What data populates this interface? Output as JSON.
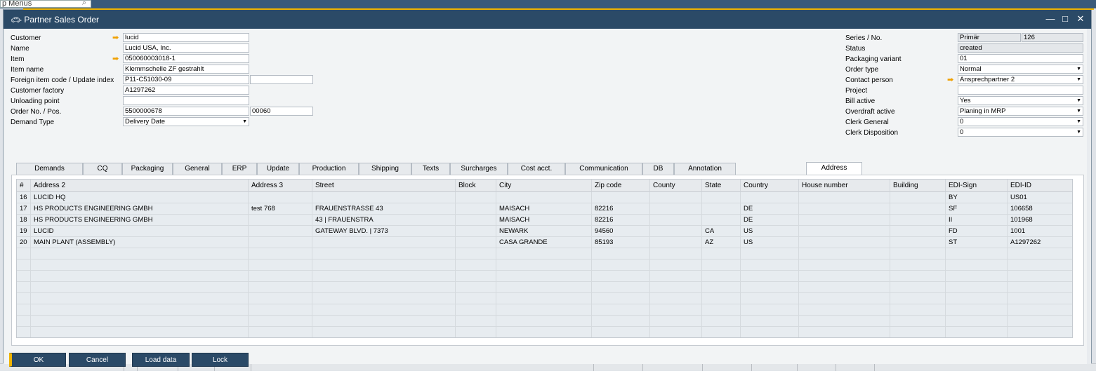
{
  "background": {
    "menu_search_text": "p Menus",
    "search_icon": "search-icon"
  },
  "window": {
    "title": "- Partner Sales Order",
    "icon": "car-icon",
    "accent_color": "#f0b400",
    "titlebar_color": "#2b4a67"
  },
  "left_fields": {
    "customer": {
      "label": "Customer",
      "value": "lucid"
    },
    "name": {
      "label": "Name",
      "value": "Lucid USA, Inc."
    },
    "item": {
      "label": "Item",
      "value": "050060003018-1"
    },
    "item_name": {
      "label": "Item name",
      "value": "Klemmschelle ZF gestrahlt"
    },
    "foreign_item": {
      "label": "Foreign item code / Update index",
      "value": "P11-C51030-09",
      "value2": ""
    },
    "customer_factory": {
      "label": "Customer factory",
      "value": "A1297262"
    },
    "unloading_point": {
      "label": "Unloading point",
      "value": ""
    },
    "order_no": {
      "label": "Order No. / Pos.",
      "value": "5500000678",
      "value2": "00060"
    },
    "demand_type": {
      "label": "Demand Type",
      "value": "Delivery Date"
    }
  },
  "right_fields": {
    "series": {
      "label": "Series / No.",
      "value": "Primär",
      "value2": "126"
    },
    "status": {
      "label": "Status",
      "value": "created"
    },
    "packaging_variant": {
      "label": "Packaging variant",
      "value": "01"
    },
    "order_type": {
      "label": "Order type",
      "value": "Normal"
    },
    "contact_person": {
      "label": "Contact person",
      "value": "Ansprechpartner 2"
    },
    "project": {
      "label": "Project",
      "value": ""
    },
    "bill_active": {
      "label": "Bill active",
      "value": "Yes"
    },
    "overdraft_active": {
      "label": "Overdraft active",
      "value": "Planing in MRP"
    },
    "clerk_general": {
      "label": "Clerk General",
      "value": "0"
    },
    "clerk_disposition": {
      "label": "Clerk Disposition",
      "value": "0"
    }
  },
  "tabs": [
    "Demands",
    "CQ",
    "Packaging",
    "General",
    "ERP",
    "Update",
    "Production",
    "Shipping",
    "Texts",
    "Surcharges",
    "Cost acct.",
    "Communication",
    "DB",
    "Annotation",
    "Address"
  ],
  "active_tab": "Address",
  "grid": {
    "columns": [
      "#",
      "Address 2",
      "Address 3",
      "Street",
      "Block",
      "City",
      "Zip code",
      "County",
      "State",
      "Country",
      "House number",
      "Building",
      "EDI-Sign",
      "EDI-ID"
    ],
    "rows": [
      [
        "16",
        "LUCID HQ",
        "",
        "",
        "",
        "",
        "",
        "",
        "",
        "",
        "",
        "",
        "BY",
        "US01"
      ],
      [
        "17",
        "HS PRODUCTS ENGINEERING GMBH",
        "test 768",
        "FRAUENSTRASSE 43",
        "",
        "MAISACH",
        "82216",
        "",
        "",
        "DE",
        "",
        "",
        "SF",
        "106658"
      ],
      [
        "18",
        "HS PRODUCTS ENGINEERING GMBH",
        "",
        "43 | FRAUENSTRA",
        "",
        "MAISACH",
        "82216",
        "",
        "",
        "DE",
        "",
        "",
        "II",
        "101968"
      ],
      [
        "19",
        "LUCID",
        "",
        "GATEWAY BLVD. | 7373",
        "",
        "NEWARK",
        "94560",
        "",
        "CA",
        "US",
        "",
        "",
        "FD",
        "1001"
      ],
      [
        "20",
        "MAIN PLANT (ASSEMBLY)",
        "",
        "",
        "",
        "CASA GRANDE",
        "85193",
        "",
        "AZ",
        "US",
        "",
        "",
        "ST",
        "A1297262"
      ]
    ]
  },
  "buttons": {
    "ok": "OK",
    "cancel": "Cancel",
    "load_data": "Load data",
    "lock": "Lock"
  }
}
